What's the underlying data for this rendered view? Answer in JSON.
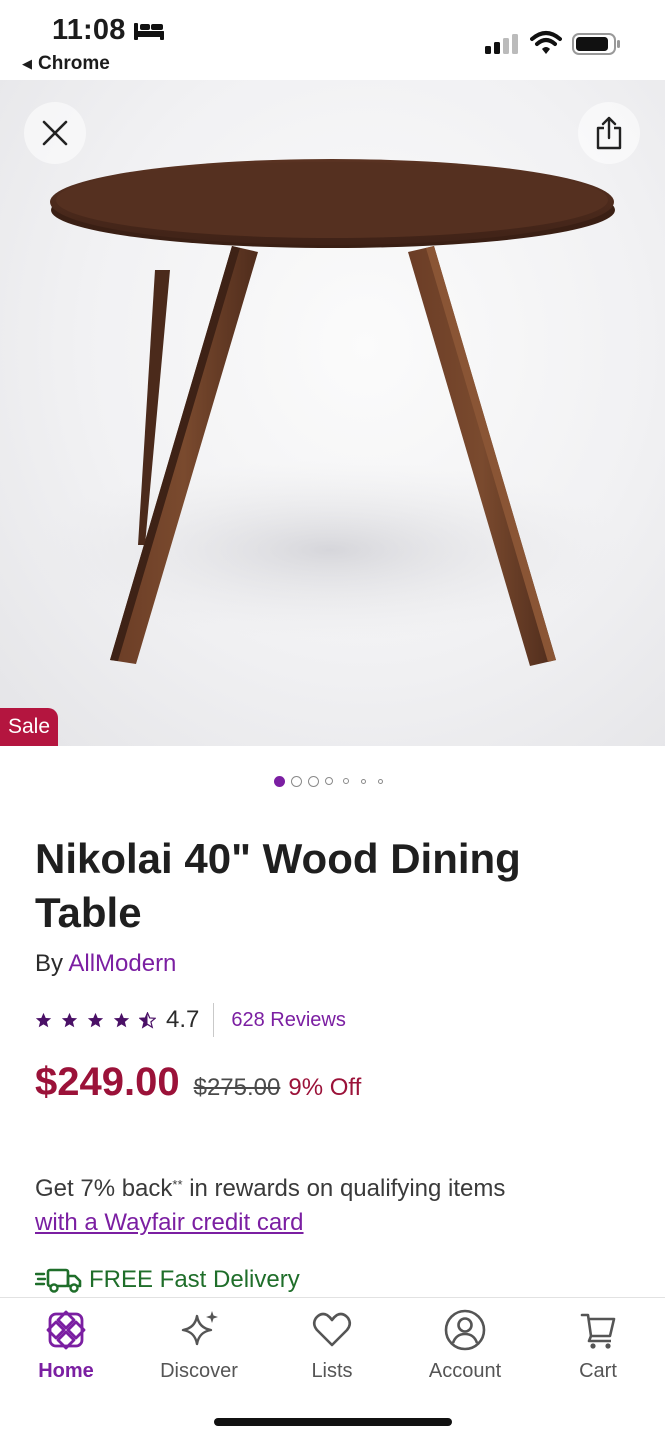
{
  "status_bar": {
    "time": "11:08",
    "back_app": "Chrome",
    "icons": [
      "bed-icon",
      "signal-icon",
      "wifi-icon",
      "battery-icon"
    ]
  },
  "hero": {
    "close_icon": "close-icon",
    "share_icon": "share-icon",
    "sale_badge": "Sale",
    "image_count": 7,
    "active_image_index": 0
  },
  "product": {
    "title": "Nikolai 40\" Wood Dining Table",
    "by_prefix": "By ",
    "brand": "AllModern",
    "rating": "4.7",
    "rating_fraction": 0.94,
    "reviews": "628 Reviews",
    "price": "$249.00",
    "old_price": "$275.00",
    "discount": "9% Off"
  },
  "rewards": {
    "text_before": "Get 7% back",
    "superscript": "**",
    "text_after": " in rewards on qualifying items",
    "link": "with a Wayfair credit card"
  },
  "delivery": {
    "label": "FREE Fast Delivery"
  },
  "bottom_nav": {
    "items": [
      {
        "label": "Home",
        "icon": "home-icon"
      },
      {
        "label": "Discover",
        "icon": "sparkle-icon"
      },
      {
        "label": "Lists",
        "icon": "heart-icon"
      },
      {
        "label": "Account",
        "icon": "account-icon"
      },
      {
        "label": "Cart",
        "icon": "cart-icon"
      }
    ],
    "active": "Home"
  },
  "colors": {
    "accent": "#7b1fa2",
    "price": "#9b1239",
    "sale": "#b4153f",
    "delivery": "#1f6e2a"
  }
}
